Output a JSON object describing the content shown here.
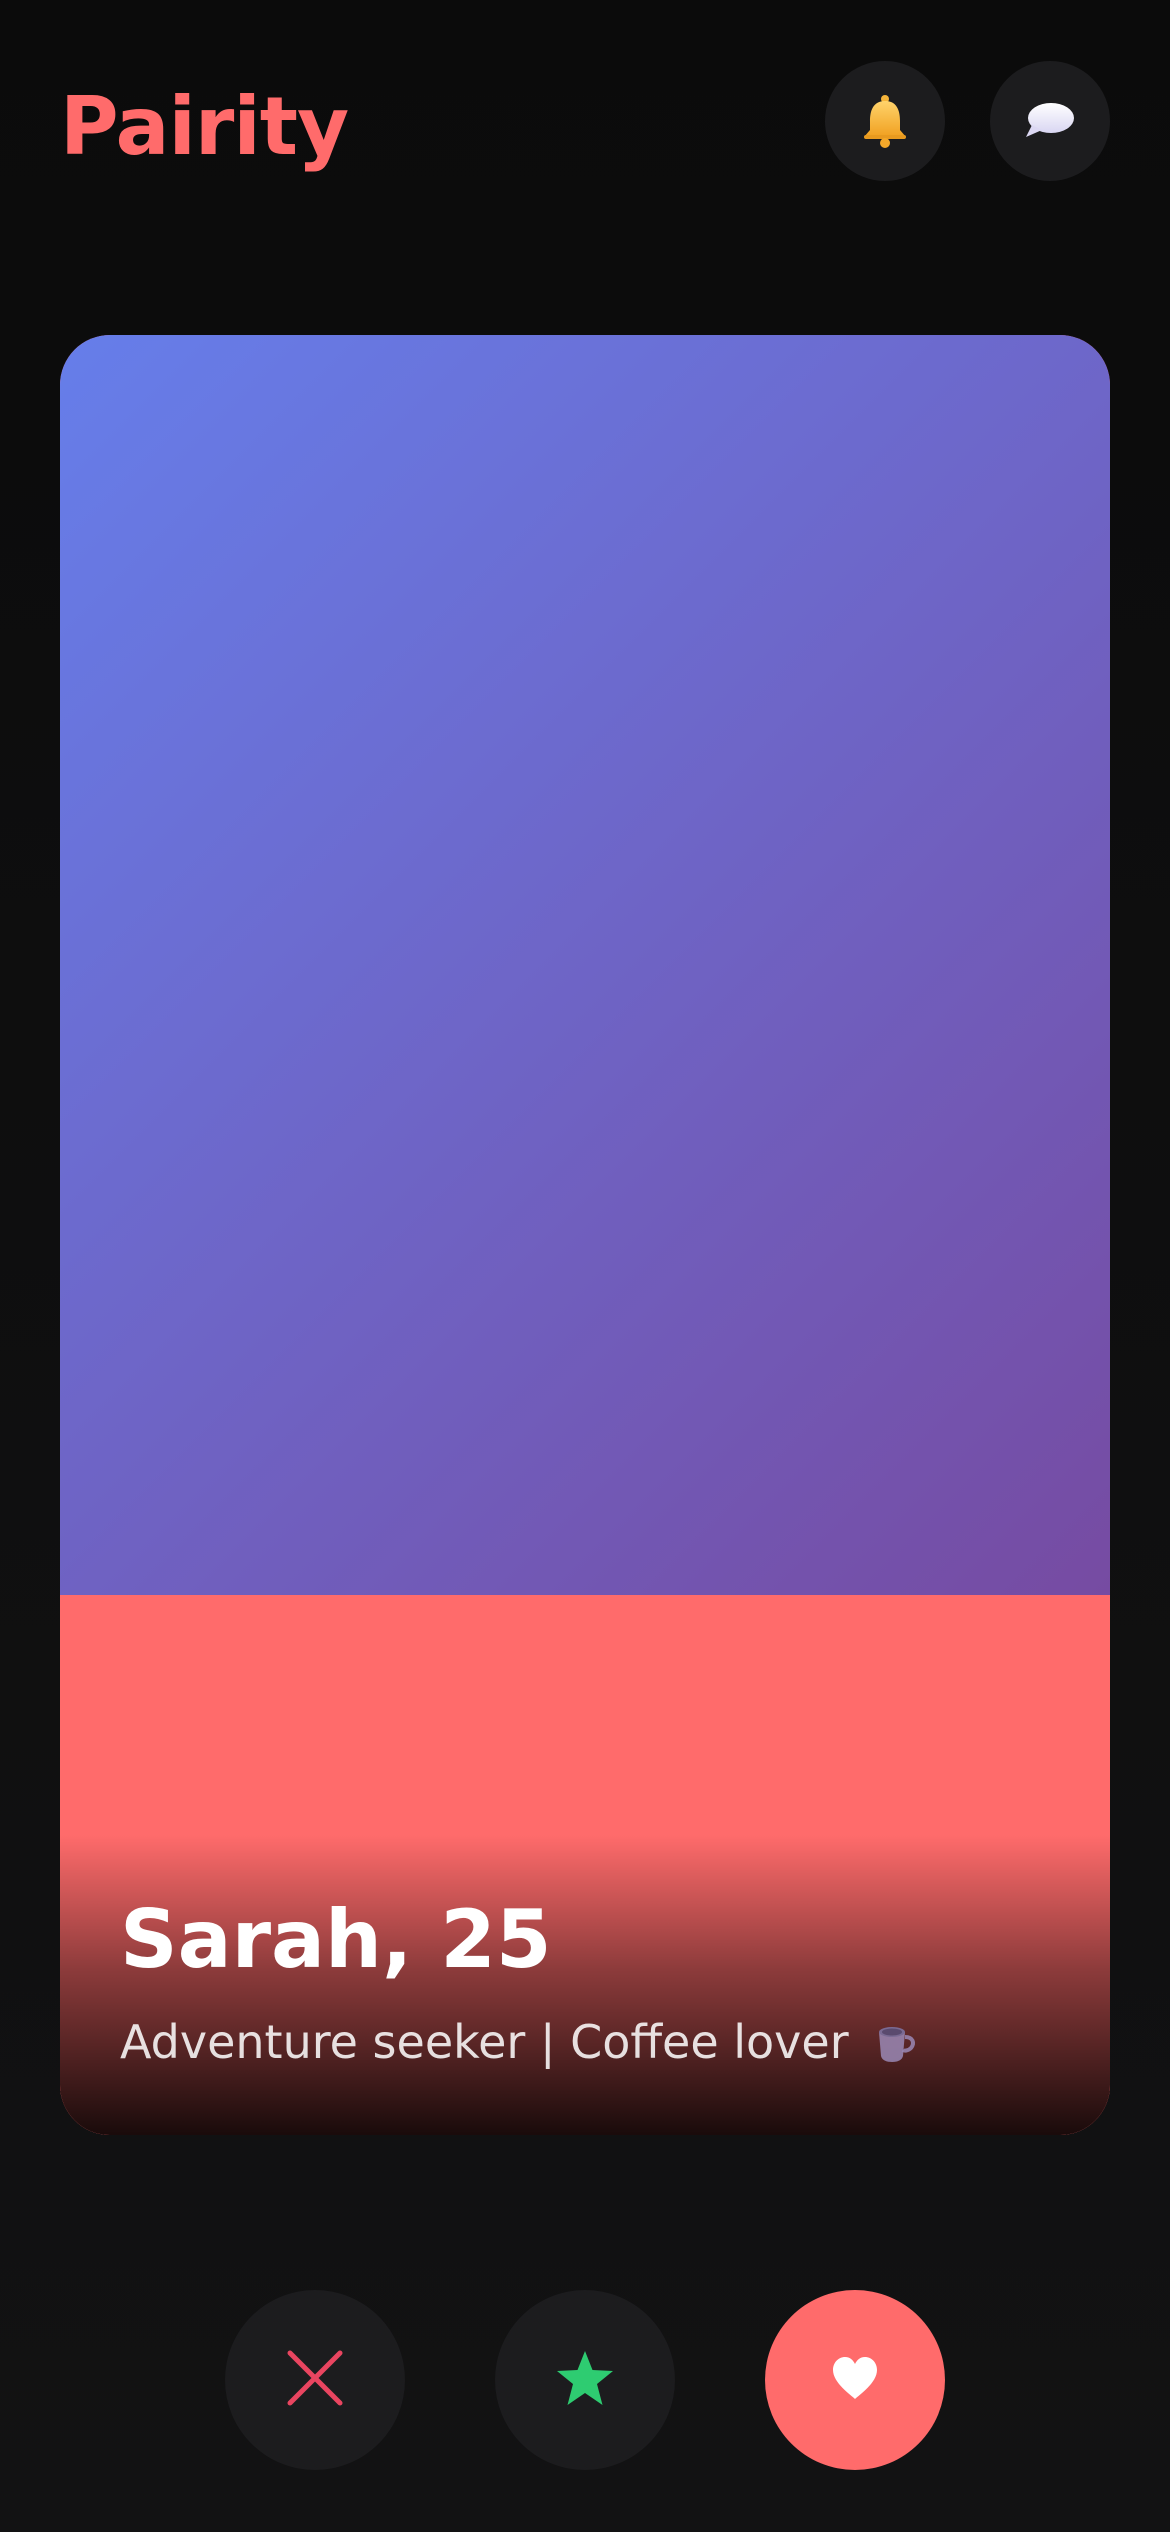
{
  "app": {
    "name": "Pairity",
    "brand_color": "#ff6b6b"
  },
  "header": {
    "logo_text": "Pairity",
    "notifications_icon": "bell-icon",
    "messages_icon": "speech-bubble-icon"
  },
  "profile": {
    "name_age": "Sarah, 25",
    "bio": "Adventure seeker | Coffee lover",
    "bio_icon": "coffee-cup-icon",
    "photo_gradient": [
      "#667eea",
      "#764ba2"
    ]
  },
  "actions": {
    "pass_icon": "close-icon",
    "pass_color": "#e94560",
    "super_like_icon": "star-icon",
    "super_like_color": "#2ecc71",
    "like_icon": "heart-icon",
    "like_color": "#ffffff"
  }
}
